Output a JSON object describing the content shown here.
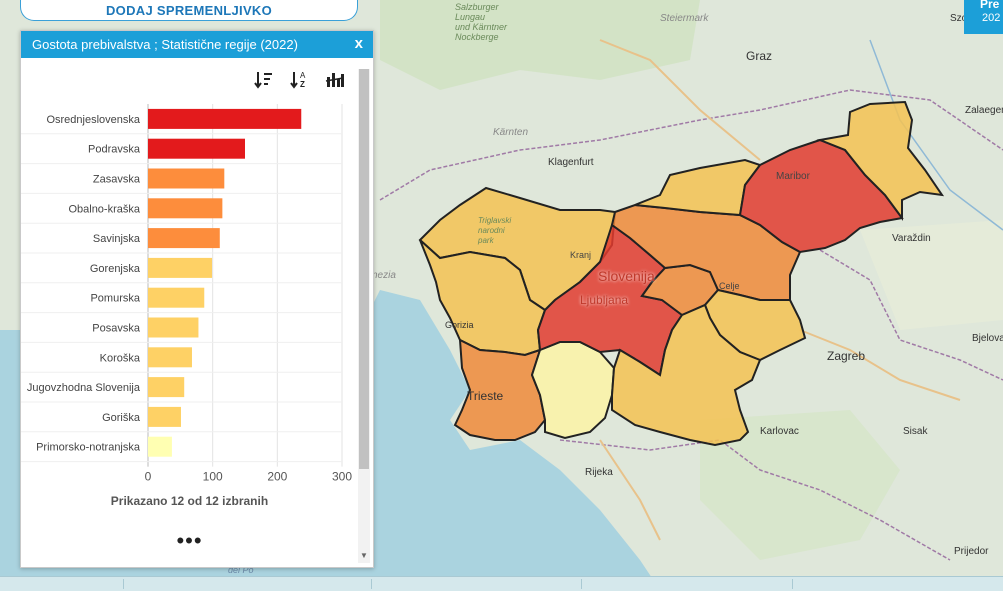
{
  "top_button": {
    "label": "DODAJ SPREMENLJIVKO"
  },
  "panel": {
    "title": "Gostota prebivalstva ; Statistične regije (2022)",
    "close": "x",
    "toolbar_icons": [
      "sort-desc-icon",
      "sort-alpha-icon",
      "bar-chart-settings-icon"
    ],
    "status": "Prikazano 12 od 12 izbranih",
    "more": "•••"
  },
  "chart_data": {
    "type": "bar",
    "orientation": "horizontal",
    "categories": [
      "Osrednjeslovenska",
      "Podravska",
      "Zasavska",
      "Obalno-kraška",
      "Savinjska",
      "Gorenjska",
      "Pomurska",
      "Posavska",
      "Koroška",
      "Jugovzhodna Slovenija",
      "Goriška",
      "Primorsko-notranjska"
    ],
    "values": [
      237,
      150,
      118,
      115,
      111,
      99,
      87,
      78,
      68,
      56,
      51,
      37
    ],
    "colors": [
      "#e31a1c",
      "#e31a1c",
      "#fd8d3c",
      "#fd8d3c",
      "#fd8d3c",
      "#fed165",
      "#fed165",
      "#fed165",
      "#fed165",
      "#fed165",
      "#fed165",
      "#ffffb2"
    ],
    "xlim": [
      0,
      300
    ],
    "xticks": [
      0,
      100,
      200,
      300
    ],
    "grid": true
  },
  "right_tab": {
    "title": "Pre",
    "year": "202"
  },
  "map": {
    "labels": {
      "graz": "Graz",
      "maribor": "Maribor",
      "celje": "Celje",
      "kranj": "Kranj",
      "ljubljana": "Ljubljana",
      "slovenija": "Slovenija",
      "zagreb": "Zagreb",
      "varazdin": "Varaždin",
      "karlovac": "Karlovac",
      "sisak": "Sisak",
      "rijeka": "Rijeka",
      "trieste": "Trieste",
      "gorizia": "Gorizia",
      "klagenfurt": "Klagenfurt",
      "karnten": "Kärnten",
      "steiermark": "Steiermark",
      "szombat": "Szombat",
      "zalaeger": "Zalaeger",
      "bjelova": "Bjelova",
      "prijedor": "Prijedor",
      "salzburger": "Salzburger\nLungau\nund Kärntner\nNockberge",
      "nezia": "nezia",
      "delpo": "del Po",
      "triglavski": "Triglavski\nnarodni\npark"
    }
  }
}
